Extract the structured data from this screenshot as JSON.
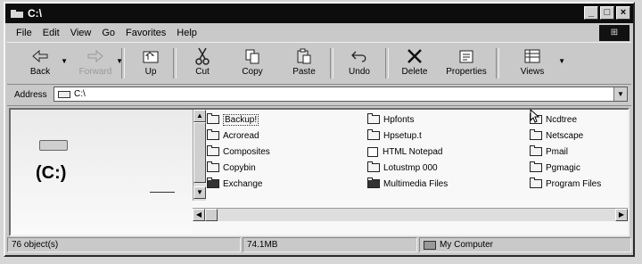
{
  "window": {
    "title": "C:\\"
  },
  "window_buttons": {
    "minimize": "_",
    "maximize": "□",
    "close": "×"
  },
  "menu": [
    "File",
    "Edit",
    "View",
    "Go",
    "Favorites",
    "Help"
  ],
  "toolbar": {
    "back": "Back",
    "forward": "Forward",
    "up": "Up",
    "cut": "Cut",
    "copy": "Copy",
    "paste": "Paste",
    "undo": "Undo",
    "delete": "Delete",
    "properties": "Properties",
    "views": "Views"
  },
  "address": {
    "label": "Address",
    "value": "C:\\"
  },
  "left_pane": {
    "drive_label": "(C:)"
  },
  "files": [
    {
      "name": "Backup!",
      "type": "folder"
    },
    {
      "name": "Acroread",
      "type": "folder"
    },
    {
      "name": "Composites",
      "type": "folder"
    },
    {
      "name": "Copybin",
      "type": "folder"
    },
    {
      "name": "Exchange",
      "type": "folder-dark"
    },
    {
      "name": "Hpfonts",
      "type": "folder"
    },
    {
      "name": "Hpsetup.t",
      "type": "folder"
    },
    {
      "name": "HTML Notepad",
      "type": "app"
    },
    {
      "name": "Lotustmp 000",
      "type": "folder"
    },
    {
      "name": "Multimedia Files",
      "type": "folder-dark"
    },
    {
      "name": "Ncdtree",
      "type": "folder"
    },
    {
      "name": "Netscape",
      "type": "folder"
    },
    {
      "name": "Pmail",
      "type": "folder"
    },
    {
      "name": "Pgmagic",
      "type": "folder"
    },
    {
      "name": "Program Files",
      "type": "folder"
    }
  ],
  "status": {
    "objects": "76 object(s)",
    "size": "74.1MB",
    "zone": "My Computer"
  },
  "icons": {
    "back": "back-arrow-icon",
    "forward": "forward-arrow-icon",
    "up": "up-folder-icon",
    "cut": "scissors-icon",
    "copy": "copy-icon",
    "paste": "paste-icon",
    "undo": "undo-icon",
    "delete": "delete-x-icon",
    "properties": "properties-icon",
    "views": "views-icon"
  }
}
